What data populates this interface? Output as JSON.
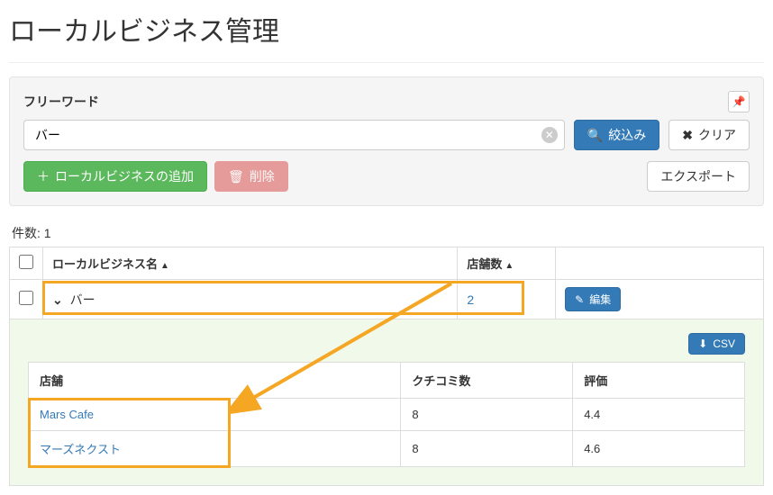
{
  "page_title": "ローカルビジネス管理",
  "filter": {
    "label": "フリーワード",
    "value": "バー",
    "search_btn": "絞込み",
    "clear_btn": "クリア"
  },
  "actions": {
    "add": "ローカルビジネスの追加",
    "delete": "削除",
    "export": "エクスポート"
  },
  "count_label": "件数:",
  "count_value": "1",
  "columns": {
    "name": "ローカルビジネス名",
    "store_count": "店舗数"
  },
  "row": {
    "name": "バー",
    "store_count": "2",
    "edit": "編集"
  },
  "detail": {
    "csv_label": "CSV",
    "columns": {
      "store": "店舗",
      "reviews": "クチコミ数",
      "rating": "評価"
    },
    "rows": [
      {
        "store": "Mars Cafe",
        "reviews": "8",
        "rating": "4.4"
      },
      {
        "store": "マーズネクスト",
        "reviews": "8",
        "rating": "4.6"
      }
    ]
  }
}
